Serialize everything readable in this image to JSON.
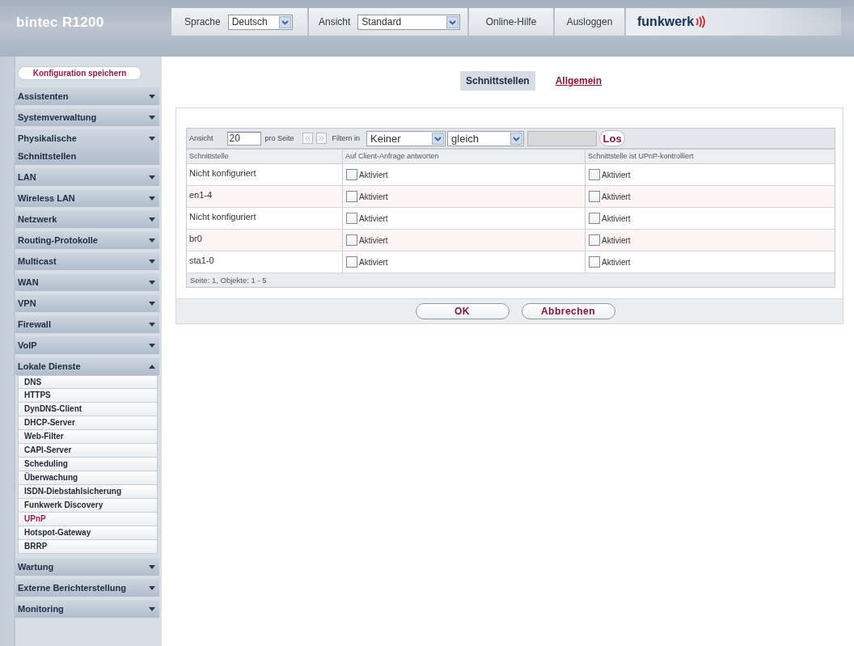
{
  "header": {
    "title": "bintec R1200",
    "language": {
      "label": "Sprache",
      "value": "Deutsch"
    },
    "view": {
      "label": "Ansicht",
      "value": "Standard"
    },
    "links": [
      "Online-Hilfe",
      "Ausloggen"
    ],
    "logo": "funkwerk"
  },
  "sidebar": {
    "save_button": "Konfiguration speichern",
    "items": [
      {
        "label": "Assistenten",
        "expanded": false
      },
      {
        "label": "Systemverwaltung",
        "expanded": false
      },
      {
        "label": "Physikalische Schnittstellen",
        "expanded": false
      },
      {
        "label": "LAN",
        "expanded": false
      },
      {
        "label": "Wireless LAN",
        "expanded": false
      },
      {
        "label": "Netzwerk",
        "expanded": false
      },
      {
        "label": "Routing-Protokolle",
        "expanded": false
      },
      {
        "label": "Multicast",
        "expanded": false
      },
      {
        "label": "WAN",
        "expanded": false
      },
      {
        "label": "VPN",
        "expanded": false
      },
      {
        "label": "Firewall",
        "expanded": false
      },
      {
        "label": "VoIP",
        "expanded": false
      },
      {
        "label": "Lokale Dienste",
        "expanded": true,
        "children": [
          {
            "label": "DNS",
            "selected": false
          },
          {
            "label": "HTTPS",
            "selected": false
          },
          {
            "label": "DynDNS-Client",
            "selected": false
          },
          {
            "label": "DHCP-Server",
            "selected": false
          },
          {
            "label": "Web-Filter",
            "selected": false
          },
          {
            "label": "CAPI-Server",
            "selected": false
          },
          {
            "label": "Scheduling",
            "selected": false
          },
          {
            "label": "Überwachung",
            "selected": false
          },
          {
            "label": "ISDN-Diebstahlsicherung",
            "selected": false
          },
          {
            "label": "Funkwerk Discovery",
            "selected": false
          },
          {
            "label": "UPnP",
            "selected": true
          },
          {
            "label": "Hotspot-Gateway",
            "selected": false
          },
          {
            "label": "BRRP",
            "selected": false
          }
        ]
      },
      {
        "label": "Wartung",
        "expanded": false
      },
      {
        "label": "Externe Berichterstellung",
        "expanded": false
      },
      {
        "label": "Monitoring",
        "expanded": false
      }
    ]
  },
  "tabs": [
    {
      "label": "Schnittstellen",
      "selected": true
    },
    {
      "label": "Allgemein",
      "selected": false
    }
  ],
  "toolbar": {
    "view_label": "Ansicht",
    "per_page": "20",
    "per_page_label": "pro Seite",
    "pager": [
      {
        "kind": "previous",
        "disabled": true
      },
      {
        "kind": "next",
        "disabled": true
      }
    ],
    "filter_label": "Filtern in",
    "filter_field": "Keiner",
    "filter_operator": "gleich",
    "filter_value": {
      "disabled": true
    },
    "go_button": "Los"
  },
  "table": {
    "columns": [
      "Schnittstelle",
      "Auf Client-Anfrage antworten",
      "Schnittstelle ist UPnP-kontrolliert"
    ],
    "rows": [
      {
        "interface": "Nicht konfiguriert",
        "checkboxes": [
          {
            "label": "Aktiviert",
            "checked": false
          },
          {
            "label": "Aktiviert",
            "checked": false
          }
        ]
      },
      {
        "interface": "en1-4",
        "checkboxes": [
          {
            "label": "Aktiviert",
            "checked": false
          },
          {
            "label": "Aktiviert",
            "checked": false
          }
        ]
      },
      {
        "interface": "Nicht konfiguriert",
        "checkboxes": [
          {
            "label": "Aktiviert",
            "checked": false
          },
          {
            "label": "Aktiviert",
            "checked": false
          }
        ]
      },
      {
        "interface": "br0",
        "checkboxes": [
          {
            "label": "Aktiviert",
            "checked": false
          },
          {
            "label": "Aktiviert",
            "checked": false
          }
        ]
      },
      {
        "interface": "sta1-0",
        "checkboxes": [
          {
            "label": "Aktiviert",
            "checked": false
          },
          {
            "label": "Aktiviert",
            "checked": false
          }
        ]
      }
    ],
    "footer": "Seite: 1, Objekte: 1 - 5"
  },
  "buttons": [
    "OK",
    "Abbrechen"
  ]
}
